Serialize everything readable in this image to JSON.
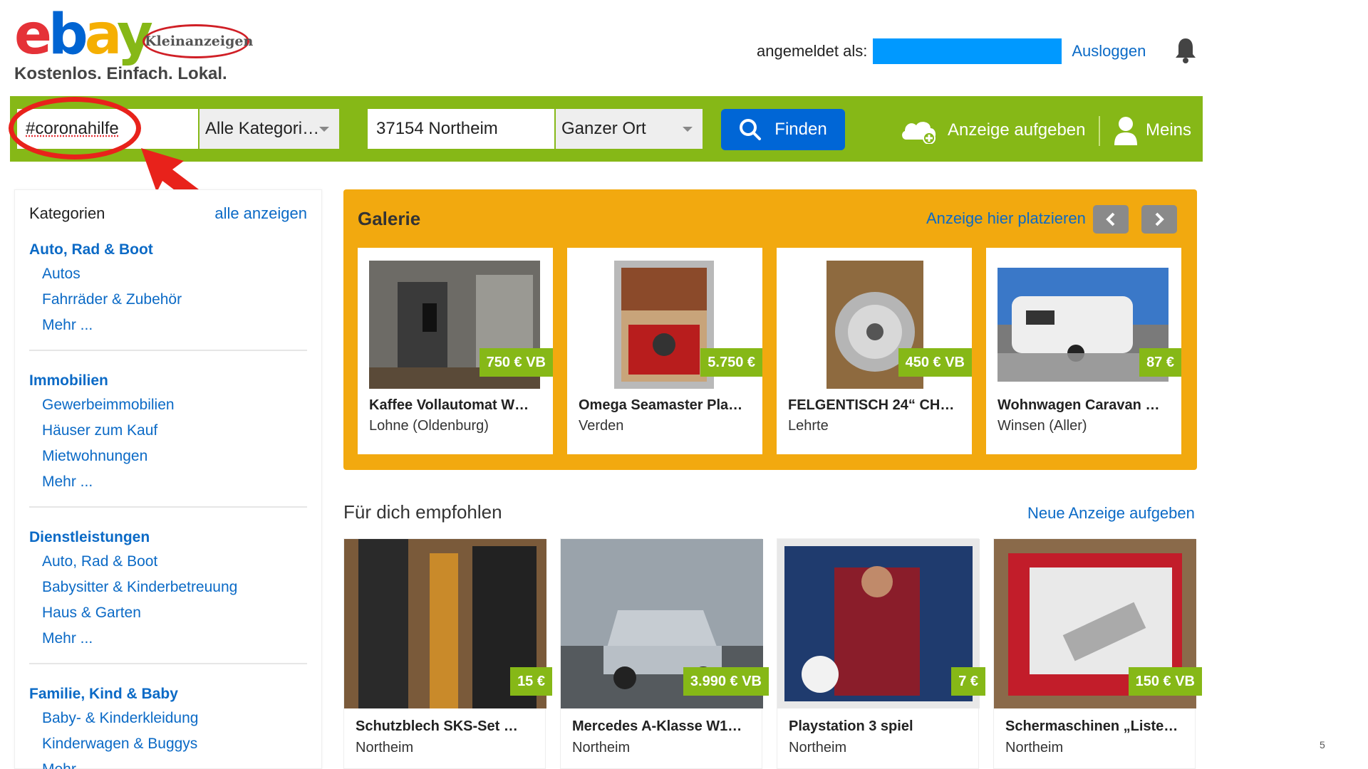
{
  "header": {
    "logo_text": "ebay",
    "badge": "Kleinanzeigen",
    "tagline": "Kostenlos. Einfach. Lokal.",
    "logged_in_label": "angemeldet als:",
    "logout": "Ausloggen"
  },
  "search": {
    "query": "#coronahilfe",
    "category": "Alle Kategori…",
    "location": "37154 Northeim",
    "radius": "Ganzer Ort",
    "find_button": "Finden",
    "post_ad": "Anzeige aufgeben",
    "mine": "Meins"
  },
  "sidebar": {
    "title": "Kategorien",
    "show_all": "alle anzeigen",
    "groups": [
      {
        "name": "Auto, Rad & Boot",
        "items": [
          "Autos",
          "Fahrräder & Zubehör",
          "Mehr ..."
        ]
      },
      {
        "name": "Immobilien",
        "items": [
          "Gewerbeimmobilien",
          "Häuser zum Kauf",
          "Mietwohnungen",
          "Mehr ..."
        ]
      },
      {
        "name": "Dienstleistungen",
        "items": [
          "Auto, Rad & Boot",
          "Babysitter & Kinderbetreuung",
          "Haus & Garten",
          "Mehr ..."
        ]
      },
      {
        "name": "Familie, Kind & Baby",
        "items": [
          "Baby- & Kinderkleidung",
          "Kinderwagen & Buggys",
          "Mehr ..."
        ]
      }
    ]
  },
  "gallery": {
    "title": "Galerie",
    "place_ad": "Anzeige hier platzieren",
    "items": [
      {
        "price": "750 € VB",
        "title": "Kaffee Vollautomat W…",
        "location": "Lohne (Oldenburg)"
      },
      {
        "price": "5.750 €",
        "title": "Omega Seamaster Pla…",
        "location": "Verden"
      },
      {
        "price": "450 € VB",
        "title": "FELGENTISCH 24“ CH…",
        "location": "Lehrte"
      },
      {
        "price": "87 €",
        "title": "Wohnwagen Caravan …",
        "location": "Winsen (Aller)"
      }
    ]
  },
  "recommended": {
    "title": "Für dich empfohlen",
    "new_ad": "Neue Anzeige aufgeben",
    "items": [
      {
        "price": "15 €",
        "title": "Schutzblech SKS-Set …",
        "location": "Northeim"
      },
      {
        "price": "3.990 € VB",
        "title": "Mercedes A-Klasse W1…",
        "location": "Northeim"
      },
      {
        "price": "7 €",
        "title": "Playstation 3 spiel",
        "location": "Northeim"
      },
      {
        "price": "150 € VB",
        "title": "Schermaschinen „Liste…",
        "location": "Northeim"
      }
    ]
  },
  "page_number": "5",
  "colors": {
    "brand_green": "#86b817",
    "link_blue": "#0b6ac6",
    "button_blue": "#0066d6",
    "gallery_orange": "#f2a90f",
    "annotation_red": "#e8221b",
    "redaction_blue": "#0099ff"
  }
}
